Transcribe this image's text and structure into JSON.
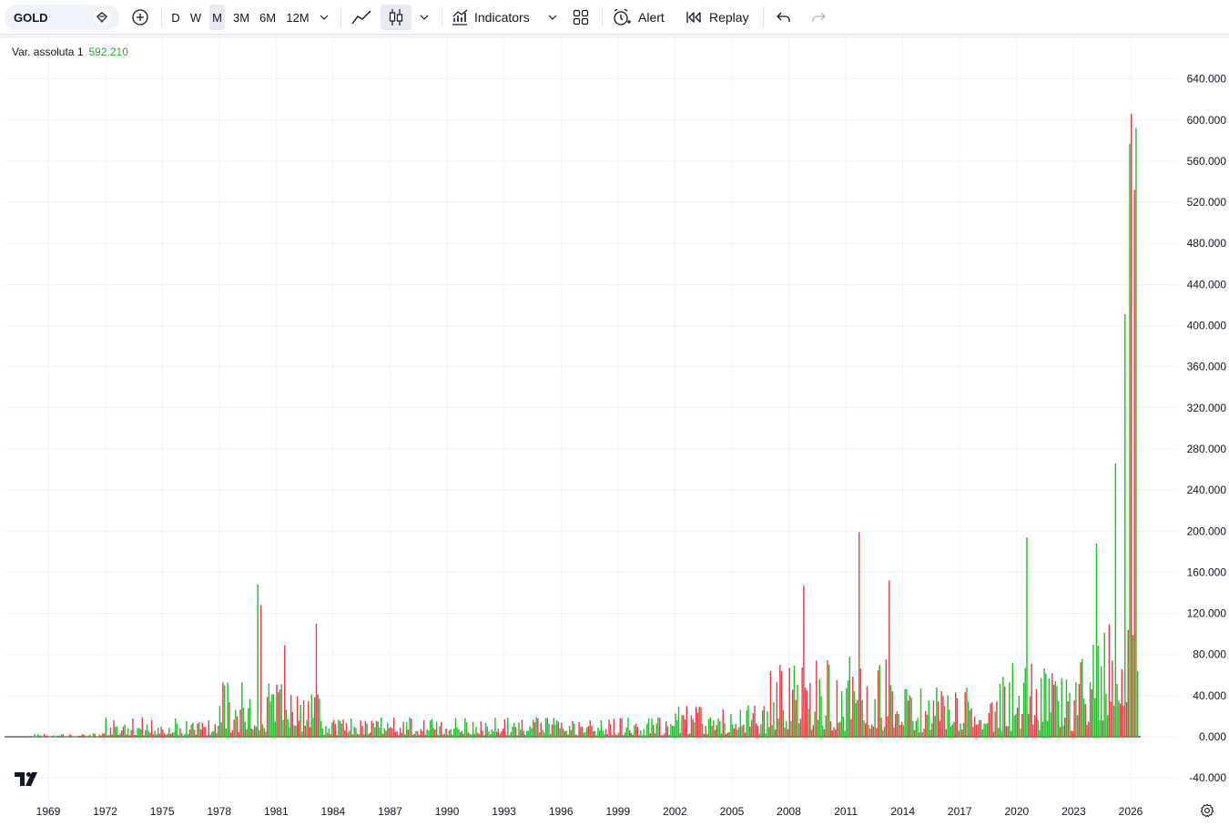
{
  "toolbar": {
    "symbol": "GOLD",
    "intervals": [
      "D",
      "W",
      "M",
      "3M",
      "6M",
      "12M"
    ],
    "active_interval": "M",
    "indicators_label": "Indicators",
    "alert_label": "Alert",
    "replay_label": "Replay"
  },
  "legend": {
    "label": "Var. assoluta 1",
    "value": "592.210"
  },
  "colors": {
    "up": "#22c02c",
    "down": "#ee3b48",
    "grid": "#f0f3fa"
  },
  "chart_data": {
    "type": "bar",
    "title": "",
    "ylim": [
      -55,
      680
    ],
    "y_ticks": [
      "640.000",
      "600.000",
      "560.000",
      "520.000",
      "480.000",
      "440.000",
      "400.000",
      "360.000",
      "320.000",
      "280.000",
      "240.000",
      "200.000",
      "160.000",
      "120.000",
      "80.000",
      "40.000",
      "0.000",
      "-40.000"
    ],
    "x_ticks": [
      "1969",
      "1972",
      "1975",
      "1978",
      "1981",
      "1984",
      "1987",
      "1990",
      "1993",
      "1996",
      "1999",
      "2002",
      "2005",
      "2008",
      "2011",
      "2014",
      "2017",
      "2020",
      "2023",
      "2026"
    ],
    "x_start": "1968-03",
    "x_end": "2026-05",
    "highlighted_bars": [
      {
        "x": "1980-01",
        "value": 148,
        "dir": "up"
      },
      {
        "x": "1980-03",
        "value": 128,
        "dir": "down"
      },
      {
        "x": "1981-06",
        "value": 89,
        "dir": "down"
      },
      {
        "x": "1983-02",
        "value": 110,
        "dir": "down"
      },
      {
        "x": "2008-10",
        "value": 147,
        "dir": "down"
      },
      {
        "x": "2011-09",
        "value": 199,
        "dir": "down"
      },
      {
        "x": "2013-04",
        "value": 152,
        "dir": "down"
      },
      {
        "x": "2020-07",
        "value": 194,
        "dir": "up"
      },
      {
        "x": "2024-03",
        "value": 188,
        "dir": "up"
      },
      {
        "x": "2025-03",
        "value": 266,
        "dir": "up"
      },
      {
        "x": "2025-09",
        "value": 411,
        "dir": "up"
      },
      {
        "x": "2025-12",
        "value": 577,
        "dir": "up"
      },
      {
        "x": "2026-01",
        "value": 606,
        "dir": "down"
      },
      {
        "x": "2026-03",
        "value": 532,
        "dir": "down"
      },
      {
        "x": "2026-04",
        "value": 592.21,
        "dir": "up"
      }
    ]
  }
}
